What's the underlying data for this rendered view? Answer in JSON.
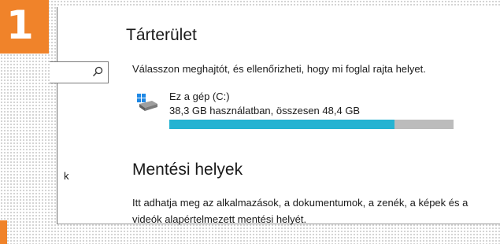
{
  "step": {
    "number": "1"
  },
  "left_panel": {
    "fragment": "k",
    "search_icon": "search-icon"
  },
  "storage": {
    "title": "Tárterület",
    "subtitle": "Válasszon meghajtót, és ellenőrizheti, hogy mi foglal rajta helyet.",
    "drive": {
      "icon": "drive-icon",
      "name": "Ez a gép (C:)",
      "usage_text": "38,3 GB használatban, összesen 48,4 GB",
      "used_gb": 38.3,
      "total_gb": 48.4
    }
  },
  "save_locations": {
    "title": "Mentési helyek",
    "description": "Itt adhatja meg az alkalmazások, a dokumentumok, a zenék, a képek és a videók alapértelmezett mentési helyét."
  },
  "colors": {
    "accent_orange": "#f0832a",
    "bar_fill": "#25b3d2",
    "bar_track": "#bcbcbc"
  }
}
